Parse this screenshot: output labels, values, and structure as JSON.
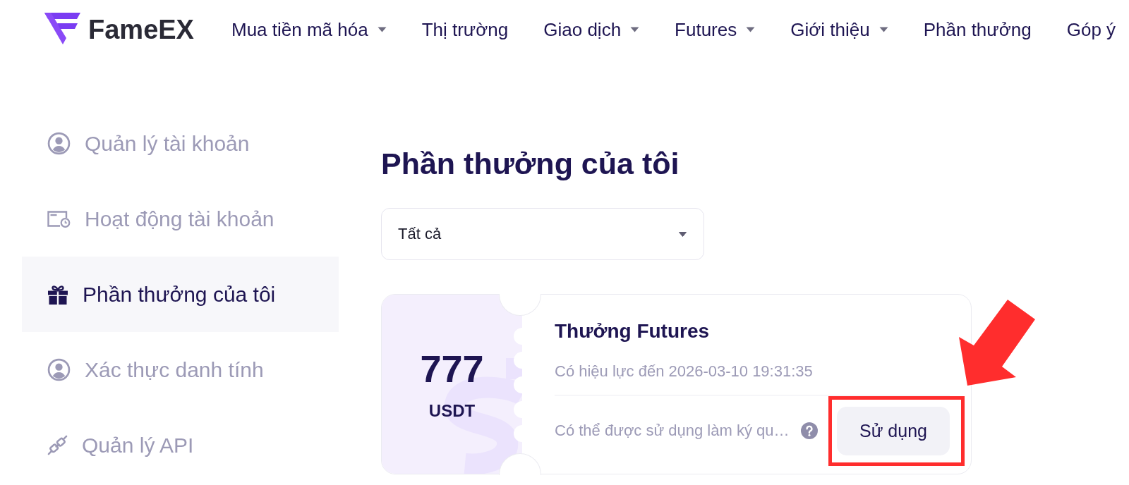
{
  "header": {
    "logo": "FameEX",
    "nav": [
      {
        "label": "Mua tiền mã hóa",
        "dropdown": true
      },
      {
        "label": "Thị trường",
        "dropdown": false
      },
      {
        "label": "Giao dịch",
        "dropdown": true
      },
      {
        "label": "Futures",
        "dropdown": true
      },
      {
        "label": "Giới thiệu",
        "dropdown": true
      },
      {
        "label": "Phần thưởng",
        "dropdown": false
      },
      {
        "label": "Góp ý",
        "dropdown": false
      }
    ]
  },
  "sidebar": {
    "items": [
      {
        "label": "Quản lý tài khoản",
        "selected": false
      },
      {
        "label": "Hoạt động tài khoản",
        "selected": false
      },
      {
        "label": "Phần thưởng của tôi",
        "selected": true
      },
      {
        "label": "Xác thực danh tính",
        "selected": false
      },
      {
        "label": "Quản lý API",
        "selected": false
      }
    ]
  },
  "content": {
    "title": "Phần thưởng của tôi",
    "filter": {
      "value": "Tất cả"
    },
    "rewards": [
      {
        "amount": "777",
        "currency": "USDT",
        "title": "Thưởng Futures",
        "validity": "Có hiệu lực đến 2026-03-10 19:31:35",
        "description": "Có thể được sử dụng làm ký qu…",
        "action": {
          "label": "Sử dụng",
          "highlighted": true
        }
      }
    ]
  }
}
